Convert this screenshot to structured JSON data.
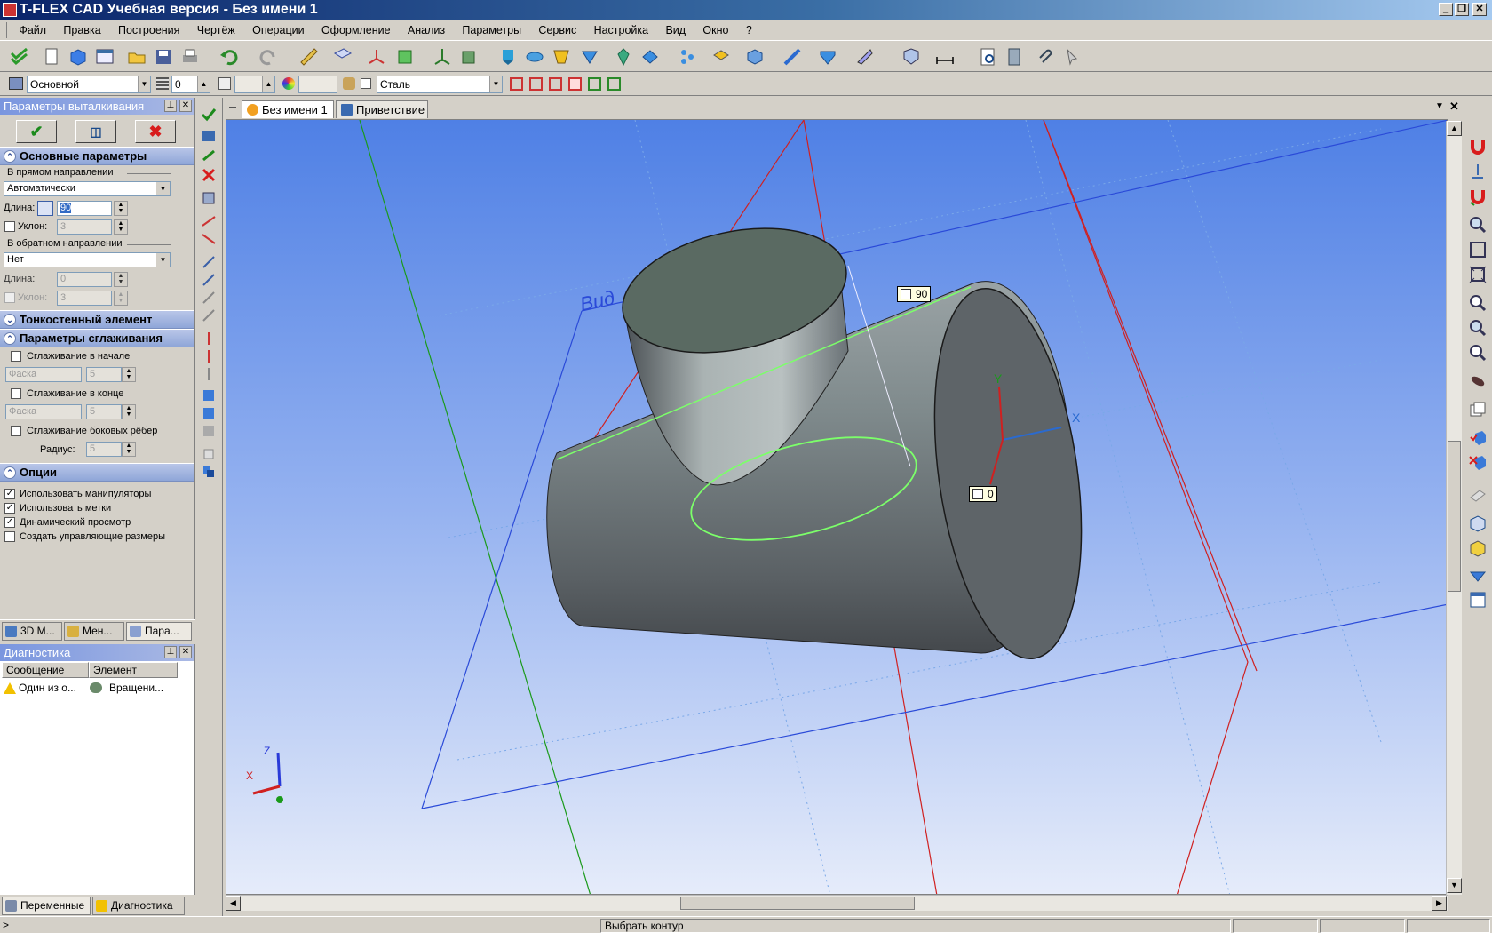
{
  "window": {
    "title": "T-FLEX CAD Учебная версия - Без имени 1",
    "buttons": [
      "_",
      "❐",
      "✕"
    ]
  },
  "menu": [
    "Файл",
    "Правка",
    "Построения",
    "Чертёж",
    "Операции",
    "Оформление",
    "Анализ",
    "Параметры",
    "Сервис",
    "Настройка",
    "Вид",
    "Окно",
    "?"
  ],
  "toolbar2": {
    "layer": "Основной",
    "level": "0",
    "material_checked": false,
    "material": "Сталь"
  },
  "extrude_panel": {
    "title": "Параметры выталкивания",
    "main_params": "Основные параметры",
    "forward_group": "В прямом направлении",
    "forward_mode": "Автоматически",
    "length_label": "Длина:",
    "forward_length": "90",
    "slope_label": "Уклон:",
    "forward_slope": "3",
    "backward_group": "В обратном направлении",
    "backward_mode": "Нет",
    "backward_length": "0",
    "backward_slope": "3",
    "thin_wall": "Тонкостенный элемент",
    "smoothing": "Параметры сглаживания",
    "smooth_start": "Сглаживание в начале",
    "smooth_start_type": "Фаска",
    "smooth_start_value": "5",
    "smooth_end": "Сглаживание в конце",
    "smooth_end_type": "Фаска",
    "smooth_end_value": "5",
    "smooth_edges": "Сглаживание боковых рёбер",
    "radius_label": "Радиус:",
    "radius_value": "5",
    "options": "Опции",
    "opt_manipulators": "Использовать манипуляторы",
    "opt_labels": "Использовать метки",
    "opt_preview": "Динамический просмотр",
    "opt_dimensions": "Создать управляющие размеры"
  },
  "left_tabs": [
    "3D М...",
    "Мен...",
    "Пара..."
  ],
  "diagnostics": {
    "title": "Диагностика",
    "col_message": "Сообщение",
    "col_element": "Элемент",
    "rows": [
      {
        "message": "Один из о...",
        "element": "Вращени..."
      }
    ]
  },
  "bottom_tabs": [
    "Переменные",
    "Диагностика"
  ],
  "doc_tabs": [
    "Без имени 1",
    "Приветствие"
  ],
  "viewport": {
    "label_top": "90",
    "label_bottom": "0",
    "plane_label": "Вид",
    "axis_labels": [
      "Z",
      "X",
      "Y",
      "X",
      "Y"
    ]
  },
  "status": {
    "message": "Выбрать контур"
  },
  "colors": {
    "title_start": "#0a246a",
    "panel_head": "#7a96df",
    "viewport_top": "#4f80e5",
    "viewport_bottom": "#e6ecfa",
    "contour": "#7cff6a"
  }
}
